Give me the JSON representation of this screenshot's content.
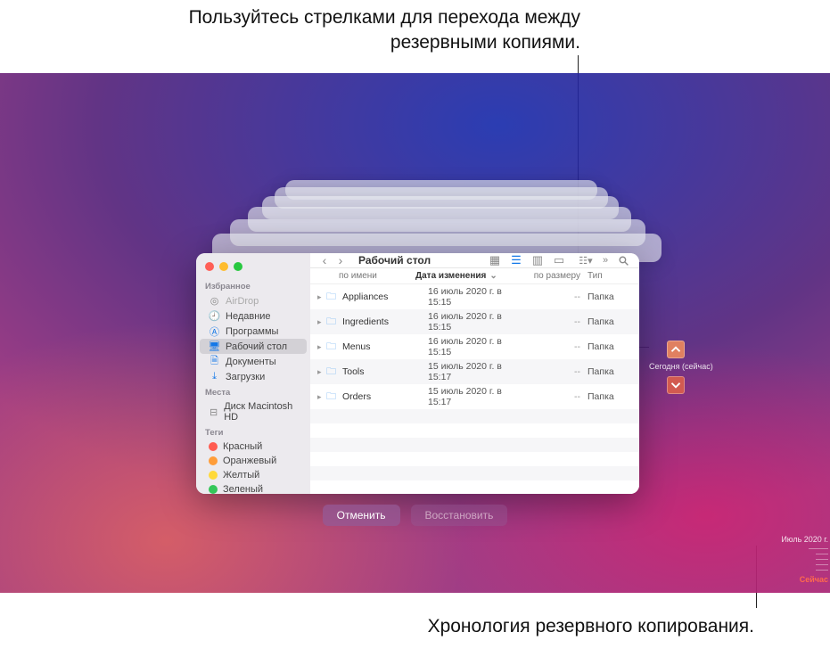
{
  "callouts": {
    "top": "Пользуйтесь стрелками для перехода между резервными копиями.",
    "bottom": "Хронология резервного копирования."
  },
  "window": {
    "title": "Рабочий стол",
    "columns": {
      "name": "по имени",
      "date": "Дата изменения",
      "size": "по размеру",
      "kind": "Тип"
    },
    "rows": [
      {
        "name": "Appliances",
        "date": "16 июль 2020 г. в 15:15",
        "size": "--",
        "kind": "Папка"
      },
      {
        "name": "Ingredients",
        "date": "16 июль 2020 г. в 15:15",
        "size": "--",
        "kind": "Папка"
      },
      {
        "name": "Menus",
        "date": "16 июль 2020 г. в 15:15",
        "size": "--",
        "kind": "Папка"
      },
      {
        "name": "Tools",
        "date": "15 июль 2020 г. в 15:17",
        "size": "--",
        "kind": "Папка"
      },
      {
        "name": "Orders",
        "date": "15 июль 2020 г. в 15:17",
        "size": "--",
        "kind": "Папка"
      }
    ]
  },
  "sidebar": {
    "favorites_head": "Избранное",
    "items": [
      {
        "label": "AirDrop",
        "icon": "airdrop-icon",
        "dim": true
      },
      {
        "label": "Недавние",
        "icon": "recents-icon"
      },
      {
        "label": "Программы",
        "icon": "apps-icon"
      },
      {
        "label": "Рабочий стол",
        "icon": "desktop-icon",
        "selected": true
      },
      {
        "label": "Документы",
        "icon": "documents-icon"
      },
      {
        "label": "Загрузки",
        "icon": "downloads-icon"
      }
    ],
    "locations_head": "Места",
    "locations": [
      {
        "label": "Диск Macintosh HD",
        "icon": "disk-icon"
      }
    ],
    "tags_head": "Теги",
    "tags": [
      {
        "label": "Красный",
        "color": "#ff5b50"
      },
      {
        "label": "Оранжевый",
        "color": "#ff9d39"
      },
      {
        "label": "Желтый",
        "color": "#ffd93a"
      },
      {
        "label": "Зеленый",
        "color": "#34c759"
      }
    ]
  },
  "nav": {
    "current_label": "Сегодня (сейчас)"
  },
  "timeline": {
    "month": "Июль 2020 г.",
    "now": "Сейчас"
  },
  "actions": {
    "cancel": "Отменить",
    "restore": "Восстановить"
  }
}
